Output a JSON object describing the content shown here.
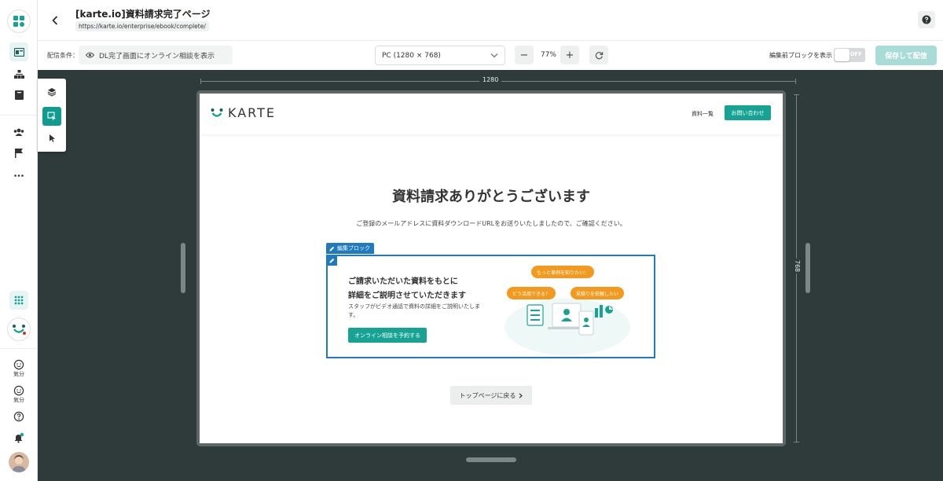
{
  "header": {
    "title": "[karte.io]資料請求完了ページ",
    "url": "https://karte.io/enterprise/ebook/complete/"
  },
  "toolbar": {
    "condition_label": "配信条件：",
    "condition_value": "DL完了画面にオンライン相談を表示",
    "device": "PC (1280 × 768)",
    "zoom": "77%",
    "zoom_out": "−",
    "zoom_in": "+",
    "toggle_label": "編集前ブロックを表示",
    "toggle_state": "OFF",
    "save_label": "保存して配信"
  },
  "rail": {
    "mood_label_1": "気分",
    "mood_label_2": "気分"
  },
  "canvas": {
    "width_label": "1280",
    "height_label": "768"
  },
  "preview": {
    "logo_text": "KARTE",
    "nav_link": "資料一覧",
    "nav_button": "お問い合わせ",
    "title": "資料請求ありがとうございます",
    "subtitle": "ご登録のメールアドレスに資料ダウンロードURLをお送りいたしましたので、ご確認ください。",
    "edit_tag": "編集ブロック",
    "block": {
      "heading_1": "ご請求いただいた資料をもとに",
      "heading_2": "詳細をご説明させていただきます",
      "description": "スタッフがビデオ通話で資料の詳細をご説明いたします。",
      "button": "オンライン相談を予約する",
      "bubble_1": "もっと事例を知りたい！",
      "bubble_2": "どう活用できる？",
      "bubble_3": "見積りを依頼したい"
    },
    "back_button": "トップページに戻る"
  },
  "colors": {
    "accent": "#17a394",
    "edit_blue": "#1f7ac0",
    "canvas_bg": "#2f3a3a",
    "bubble_orange": "#f39a1e"
  }
}
